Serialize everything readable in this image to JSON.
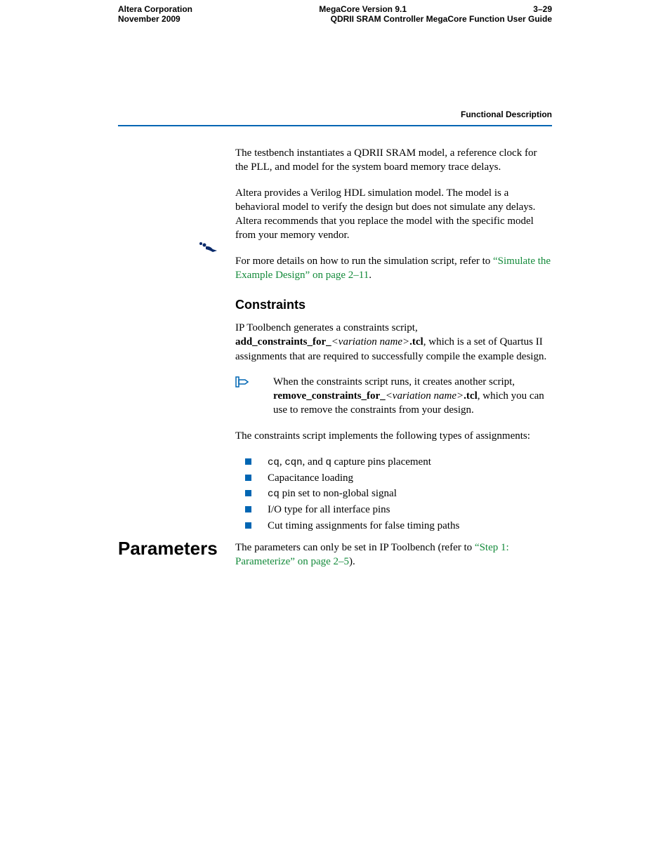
{
  "header": {
    "running_head": "Functional Description"
  },
  "body": {
    "p1": "The testbench instantiates a QDRII SRAM model, a reference clock for the PLL, and model for the system board memory trace delays.",
    "p2": "Altera provides a Verilog HDL simulation model. The model is a behavioral model to verify the design but does not simulate any delays. Altera recommends that you replace the model with the specific model from your memory vendor.",
    "p3_pre": "For more details on how to run the simulation script, refer to ",
    "p3_link": "“Simulate the Example Design” on page 2–11",
    "p3_post": ".",
    "h_constraints": "Constraints",
    "p4_pre": "IP Toolbench generates a constraints script, ",
    "p4_bold1": "add_constraints_for_",
    "p4_ital1": "<variation name>",
    "p4_bold2": ".tcl",
    "p4_post": ", which is a set of Quartus II assignments that are required to successfully compile the example design.",
    "note_pre": "When the constraints script runs, it creates another script, ",
    "note_bold1": "remove_constraints_for_",
    "note_ital1": "<variation name>",
    "note_bold2": ".tcl",
    "note_post": ", which you can use to remove the constraints from your design.",
    "p5": "The constraints script implements the following types of assignments:",
    "bullets": {
      "b1_sig1": "cq",
      "b1_mid1": ", ",
      "b1_sig2": "cqn",
      "b1_mid2": ", and ",
      "b1_sig3": "q",
      "b1_end": " capture pins placement",
      "b2": "Capacitance loading",
      "b3_sig": "cq",
      "b3_end": " pin set to non-global signal",
      "b4": "I/O type for all interface pins",
      "b5": "Cut timing assignments for false timing paths"
    },
    "h_parameters": "Parameters",
    "p6_pre": "The parameters can only be set in IP Toolbench (refer to ",
    "p6_link": "“Step 1: Parameterize” on page 2–5",
    "p6_post": ")."
  },
  "footer": {
    "left1": "Altera Corporation",
    "center1": "MegaCore Version 9.1",
    "right1": "3–29",
    "left2": "November 2009",
    "right2": "QDRII SRAM Controller MegaCore Function User Guide"
  }
}
